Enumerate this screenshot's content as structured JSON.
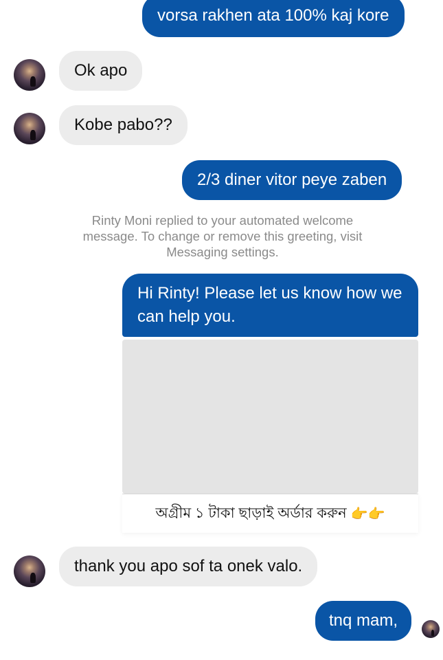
{
  "thread": {
    "msg1": "vorsa rakhen ata 100% kaj kore",
    "msg2": "Ok apo",
    "msg3": "Kobe pabo??",
    "msg4": "2/3 diner vitor peye zaben",
    "notice": "Rinty Moni replied to your automated welcome message. To change or remove this greeting, visit Messaging settings.",
    "card_text": "Hi Rinty! Please let us know how we can help you.",
    "card_footer": "অগ্রীম ১ টাকা ছাড়াই অর্ডার করুন",
    "card_footer_icons": "👉👉",
    "msg5": "thank you apo sof ta onek valo.",
    "msg6": "tnq mam,"
  },
  "colors": {
    "outgoing": "#0a55a6",
    "incoming": "#ececec",
    "notice_text": "#8a8a8a"
  },
  "icons": {
    "avatar": "contact-avatar",
    "pointing": "pointing-hand-icon"
  }
}
